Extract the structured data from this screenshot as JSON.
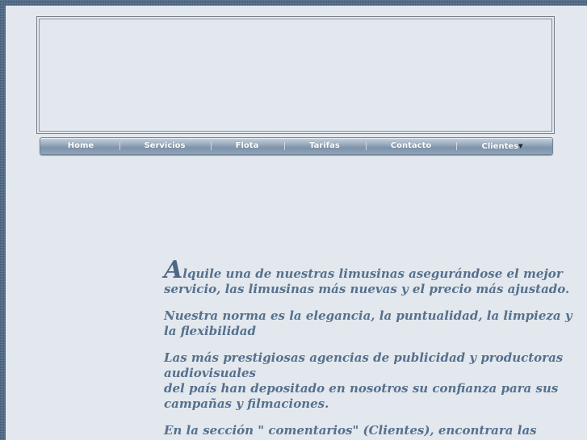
{
  "nav": {
    "items": [
      {
        "label": "Home"
      },
      {
        "label": "Servicios"
      },
      {
        "label": "Flota"
      },
      {
        "label": "Tarifas"
      },
      {
        "label": "Contacto"
      },
      {
        "label": "Clientes"
      }
    ],
    "dropdown_caret": "▼"
  },
  "content": {
    "intro_dropcap": "A",
    "intro_rest": "lquile una de nuestras limusinas asegurándose el mejor servicio, las limusinas más nuevas y el precio más ajustado.",
    "p2": "Nuestra norma es la elegancia, la puntualidad, la limpieza y la flexibilidad",
    "p3_line1": "Las más prestigiosas agencias de publicidad y productoras audiovisuales",
    "p3_line2": "del país han depositado en nosotros su confianza para sus campañas y filmaciones.",
    "p4": "En la sección \" comentarios\" (Clientes), encontrara las"
  },
  "colors": {
    "page_bg": "#e2e8ee",
    "outer_bg": "#4f6a88",
    "text": "#56708d",
    "nav_text": "#ffffff"
  }
}
